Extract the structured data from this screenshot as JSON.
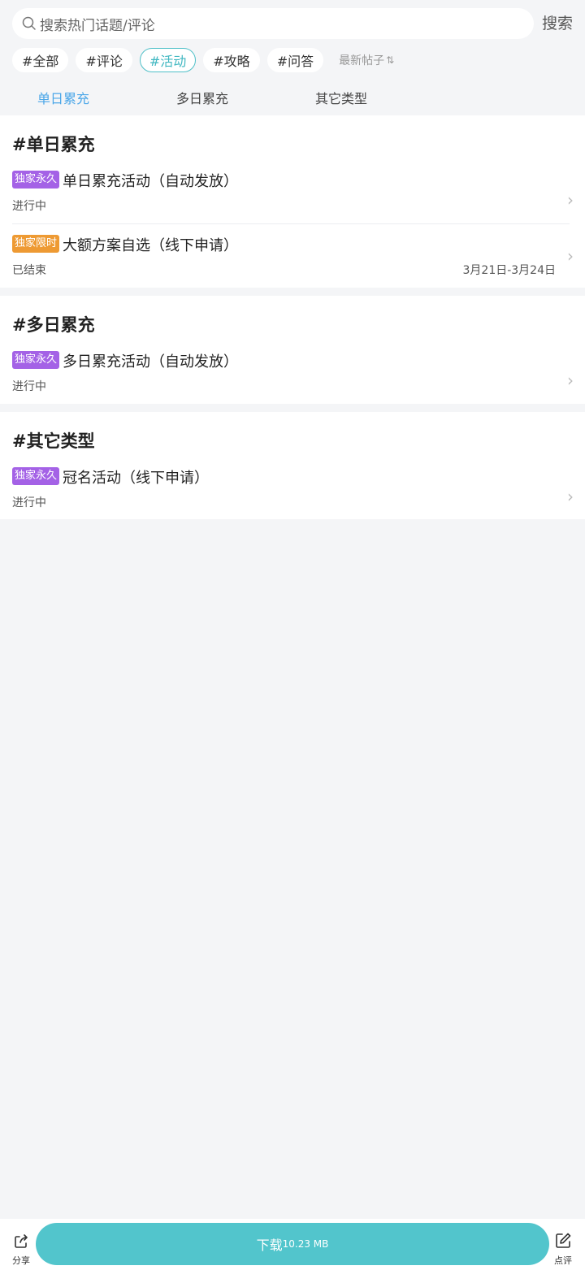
{
  "search": {
    "placeholder": "搜索热门话题/评论",
    "button_label": "搜索"
  },
  "chips": [
    "#全部",
    "#评论",
    "#活动",
    "#攻略",
    "#问答"
  ],
  "active_chip": "#活动",
  "sort": {
    "label": "最新帖子",
    "icon": "sort-arrows-icon"
  },
  "tabs": [
    "单日累充",
    "多日累充",
    "其它类型"
  ],
  "active_tab": "单日累充",
  "sections": [
    {
      "title": "#单日累充",
      "items": [
        {
          "badge": "独家永久",
          "badge_color": "#a462e6",
          "title": "单日累充活动（自动发放）",
          "status": "进行中",
          "date": ""
        },
        {
          "badge": "独家限时",
          "badge_color": "#ee9a33",
          "title": "大额方案自选（线下申请）",
          "status": "已结束",
          "date": "3月21日-3月24日"
        }
      ]
    },
    {
      "title": "#多日累充",
      "items": [
        {
          "badge": "独家永久",
          "badge_color": "#a462e6",
          "title": "多日累充活动（自动发放）",
          "status": "进行中",
          "date": ""
        }
      ]
    },
    {
      "title": "#其它类型",
      "items": [
        {
          "badge": "独家永久",
          "badge_color": "#a462e6",
          "title": "冠名活动（线下申请）",
          "status": "进行中",
          "date": ""
        }
      ]
    }
  ],
  "bottom": {
    "share_label": "分享",
    "download_label": "下载",
    "download_size": "10.23 MB",
    "review_label": "点评"
  },
  "colors": {
    "accent": "#52c5cc",
    "active_tab": "#4aa6e8",
    "badge_permanent": "#a462e6",
    "badge_limited": "#ee9a33"
  }
}
